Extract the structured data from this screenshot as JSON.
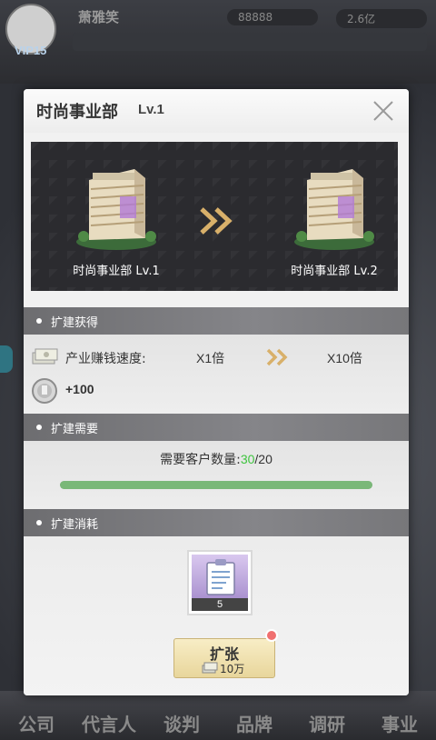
{
  "hud": {
    "player_name": "萧雅笑",
    "vip": "VIP15",
    "stat1": "88888",
    "stat2": "2.6亿"
  },
  "nav": [
    {
      "label": "公司"
    },
    {
      "label": "代言人"
    },
    {
      "label": "谈判"
    },
    {
      "label": "品牌"
    },
    {
      "label": "调研"
    },
    {
      "label": "事业"
    }
  ],
  "modal": {
    "title": "时尚事业部",
    "level": "Lv.1",
    "current_building": "时尚事业部 Lv.1",
    "next_building": "时尚事业部 Lv.2"
  },
  "gain": {
    "header": "扩建获得",
    "speed_label": "产业赚钱速度:",
    "speed_from": "X1倍",
    "speed_to": "X10倍",
    "bonus": "+100"
  },
  "requirement": {
    "header": "扩建需要",
    "label": "需要客户数量:",
    "current": "30",
    "separator": "/",
    "total": "20",
    "progress": 1.0
  },
  "cost": {
    "header": "扩建消耗",
    "item_count": "5",
    "button_label": "扩张",
    "button_cost": "10万"
  },
  "colors": {
    "accent_green": "#3fc43f",
    "progress_fill": "#7ab878",
    "notify_dot": "#f07070",
    "arrow_gold": "#d8b06a"
  }
}
